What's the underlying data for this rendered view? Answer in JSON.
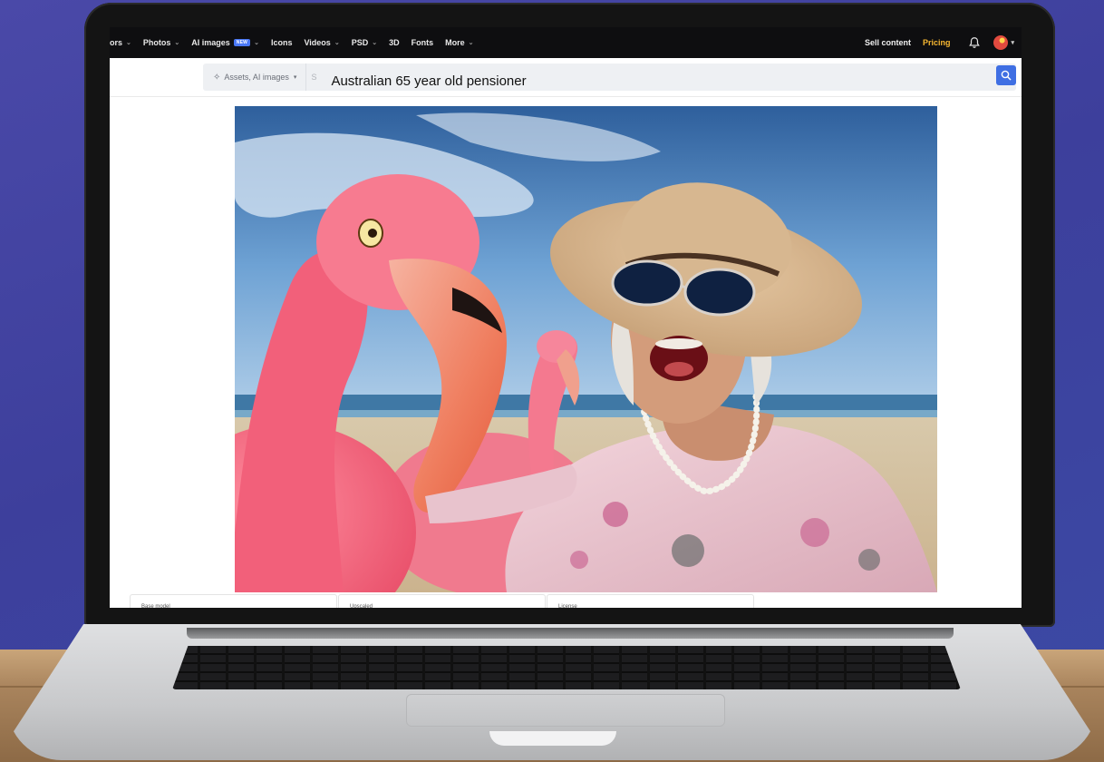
{
  "nav": {
    "items": [
      {
        "label": "ors",
        "chevron": true
      },
      {
        "label": "Photos",
        "chevron": true
      },
      {
        "label": "AI images",
        "badge": "NEW",
        "chevron": true
      },
      {
        "label": "Icons",
        "chevron": false
      },
      {
        "label": "Videos",
        "chevron": true
      },
      {
        "label": "PSD",
        "chevron": true
      },
      {
        "label": "3D",
        "chevron": false
      },
      {
        "label": "Fonts",
        "chevron": false
      },
      {
        "label": "More",
        "chevron": true
      }
    ],
    "sell_content": "Sell content",
    "pricing": "Pricing",
    "colors": {
      "pricing": "#f7b731",
      "badge": "#4a78f5",
      "search_button": "#3f6fe3"
    }
  },
  "search": {
    "filter_label": "Assets, AI images",
    "placeholder_stub": "S",
    "query": "Australian 65 year old pensioner"
  },
  "cards": [
    {
      "label": "Base model"
    },
    {
      "label": "Upscaled"
    },
    {
      "label": "License"
    }
  ]
}
